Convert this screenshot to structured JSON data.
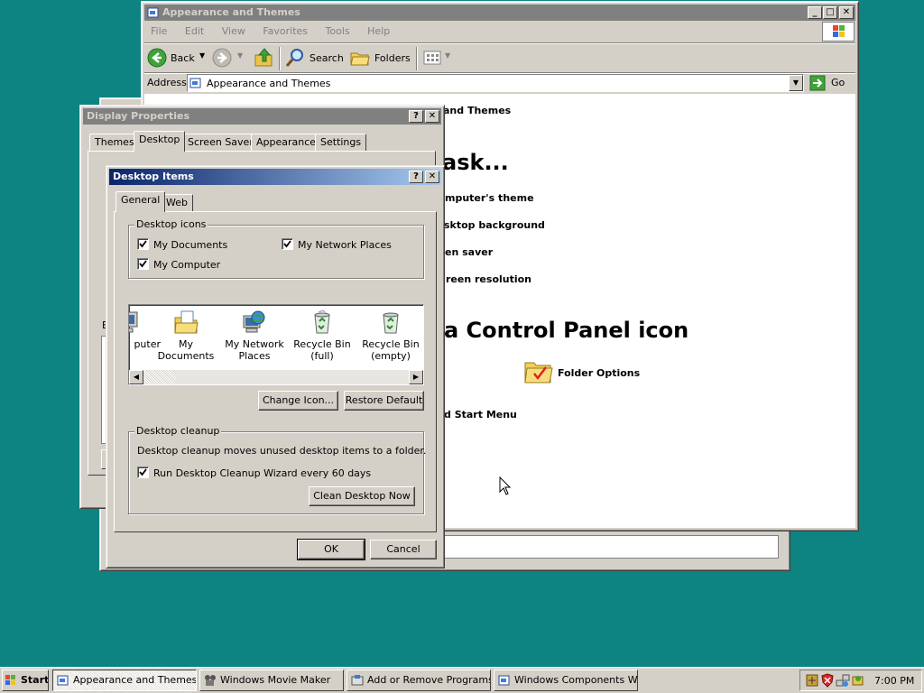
{
  "explorer": {
    "title": "Appearance and Themes",
    "menu": [
      "File",
      "Edit",
      "View",
      "Favorites",
      "Tools",
      "Help"
    ],
    "toolbar": {
      "back": "Back",
      "search": "Search",
      "folders": "Folders"
    },
    "address_label": "Address",
    "address_value": "Appearance and Themes",
    "go_label": "Go",
    "content": {
      "heading_partial": "and Themes",
      "pick_task": "ask...",
      "tasks": [
        "mputer's theme",
        "sktop background",
        "en saver",
        "reen resolution"
      ],
      "pick_icon": "a Control Panel icon",
      "icons": [
        "Folder Options",
        "d Start Menu"
      ]
    }
  },
  "display_props": {
    "title": "Display Properties",
    "tabs": [
      "Themes",
      "Desktop",
      "Screen Saver",
      "Appearance",
      "Settings"
    ],
    "partial_label": "B"
  },
  "desktop_items": {
    "title": "Desktop Items",
    "tabs": [
      "General",
      "Web"
    ],
    "icons_group": "Desktop icons",
    "checks": [
      {
        "label": "My Documents",
        "checked": true
      },
      {
        "label": "My Network Places",
        "checked": true
      },
      {
        "label": "My Computer",
        "checked": true
      }
    ],
    "list_items": [
      {
        "label": "puter",
        "icon": "computer-icon"
      },
      {
        "label": "My Documents",
        "icon": "my-documents-icon"
      },
      {
        "label": "My Network Places",
        "icon": "network-places-icon"
      },
      {
        "label": "Recycle Bin (full)",
        "icon": "recycle-bin-full-icon"
      },
      {
        "label": "Recycle Bin (empty)",
        "icon": "recycle-bin-empty-icon"
      }
    ],
    "change_icon": "Change Icon...",
    "restore_default": "Restore Default",
    "cleanup_group": "Desktop cleanup",
    "cleanup_text": "Desktop cleanup moves unused desktop items to a folder.",
    "cleanup_check": "Run Desktop Cleanup Wizard every 60 days",
    "clean_now": "Clean Desktop Now",
    "ok": "OK",
    "cancel": "Cancel"
  },
  "taskbar": {
    "start": "Start",
    "tasks": [
      "Appearance and Themes",
      "Windows Movie Maker",
      "Add or Remove Programs",
      "Windows Components W..."
    ],
    "clock": "7:00 PM"
  },
  "colors": {
    "desktop": "#0d8481",
    "title_active": "#0a246a",
    "title_inactive": "#808080"
  }
}
